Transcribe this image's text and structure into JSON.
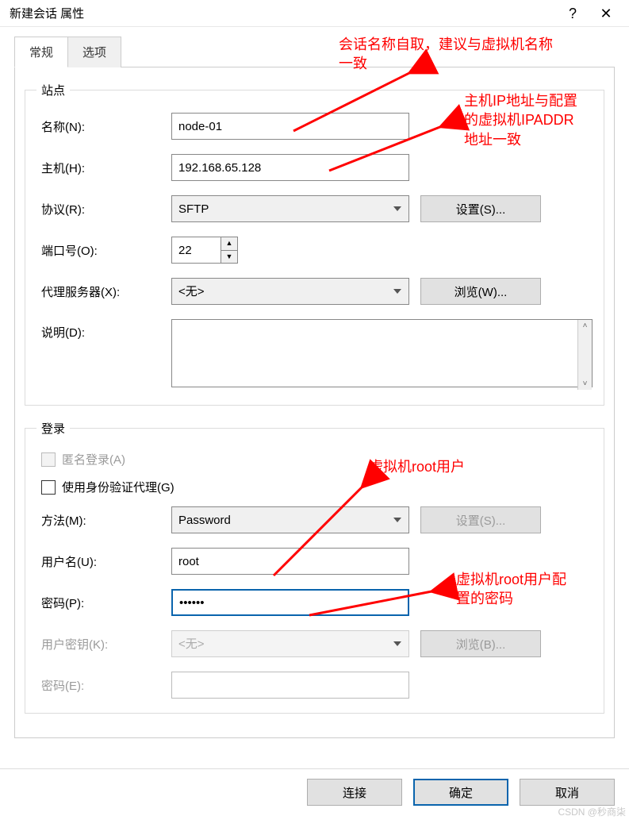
{
  "window": {
    "title": "新建会话 属性",
    "help": "?",
    "close": "✕"
  },
  "tabs": {
    "general": "常规",
    "options": "选项"
  },
  "site": {
    "legend": "站点",
    "name_label": "名称(N):",
    "name_value": "node-01",
    "host_label": "主机(H):",
    "host_value": "192.168.65.128",
    "protocol_label": "协议(R):",
    "protocol_value": "SFTP",
    "settings_btn": "设置(S)...",
    "port_label": "端口号(O):",
    "port_value": "22",
    "proxy_label": "代理服务器(X):",
    "proxy_value": "<无>",
    "browse_btn": "浏览(W)...",
    "desc_label": "说明(D):",
    "desc_value": ""
  },
  "login": {
    "legend": "登录",
    "anon_label": "匿名登录(A)",
    "agent_label": "使用身份验证代理(G)",
    "method_label": "方法(M):",
    "method_value": "Password",
    "settings_btn": "设置(S)...",
    "user_label": "用户名(U):",
    "user_value": "root",
    "pwd_label": "密码(P):",
    "pwd_value": "••••••",
    "key_label": "用户密钥(K):",
    "key_value": "<无>",
    "browse_btn": "浏览(B)...",
    "passphrase_label": "密码(E):",
    "passphrase_value": ""
  },
  "footer": {
    "connect": "连接",
    "ok": "确定",
    "cancel": "取消"
  },
  "annotations": {
    "a1": "会话名称自取，建议与虚拟机名称\n一致",
    "a2": "主机IP地址与配置\n的虚拟机IPADDR\n地址一致",
    "a3": "虚拟机root用户",
    "a4": "虚拟机root用户配\n置的密码"
  },
  "watermark": "CSDN @秒商柒"
}
